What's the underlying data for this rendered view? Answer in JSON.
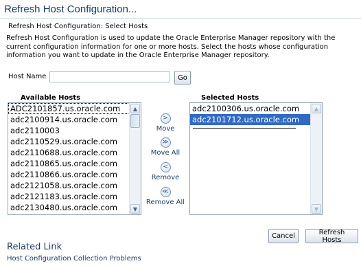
{
  "page": {
    "title": "Refresh Host Configuration...",
    "step_title": "Refresh Host Configuration: Select Hosts",
    "description": "Refresh Host Configuration is used to update the Oracle Enterprise Manager repository with the current configuration information for one or more hosts. Select the hosts whose configuration information you want to update in the Oracle Enterprise Manager repository."
  },
  "search": {
    "label": "Host Name",
    "value": "",
    "go_label": "Go"
  },
  "available": {
    "header": "Available Hosts",
    "items": [
      "ADC2101857.us.oracle.com",
      "adc2100914.us.oracle.com",
      "adc2110003",
      "adc2110529.us.oracle.com",
      "adc2110688.us.oracle.com",
      "adc2110865.us.oracle.com",
      "adc2110866.us.oracle.com",
      "adc2121058.us.oracle.com",
      "adc2121183.us.oracle.com",
      "adc2130480.us.oracle.com"
    ]
  },
  "selected": {
    "header": "Selected Hosts",
    "items": [
      "adc2100306.us.oracle.com",
      "adc2101712.us.oracle.com"
    ]
  },
  "shuttle": {
    "move": "Move",
    "move_all": "Move All",
    "remove": "Remove",
    "remove_all": "Remove All"
  },
  "icons": {
    "move": ">",
    "move_all": "≫",
    "remove": "<",
    "remove_all": "≪",
    "scroll_up": "▲",
    "scroll_down": "▼"
  },
  "buttons": {
    "cancel": "Cancel",
    "refresh": "Refresh Hosts"
  },
  "related": {
    "title": "Related Link",
    "link": "Host Configuration Collection Problems"
  },
  "colors": {
    "title": "#1c3c6e",
    "selection": "#316ac5"
  }
}
